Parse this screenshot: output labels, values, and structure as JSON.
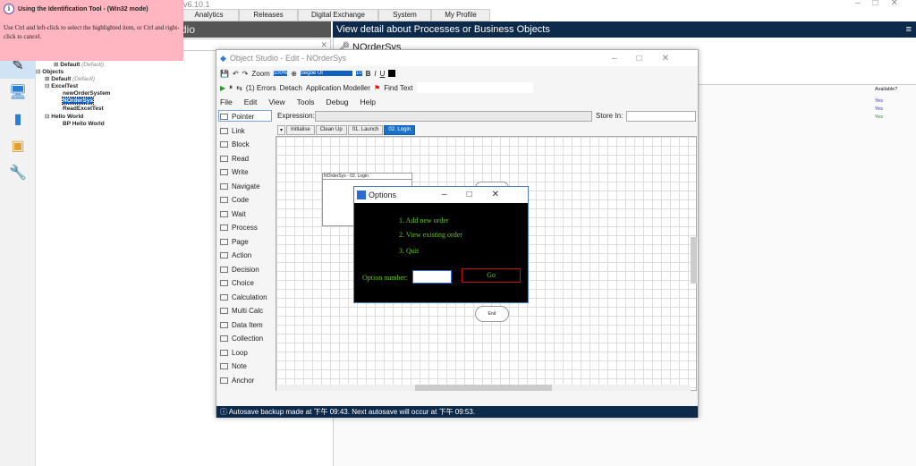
{
  "app": {
    "version": "v6.10.1",
    "nav_tabs": [
      "Analytics",
      "Releases",
      "Digital Exchange",
      "System",
      "My Profile"
    ],
    "left_header": "dio"
  },
  "tooltip": {
    "title": "Using the Identification Tool - (Win32 mode)",
    "body": "Use Ctrl and left-click to select the highlighted item, or Ctrl and right-click to cancel."
  },
  "tree": [
    {
      "label": "Default",
      "note": "(Default)"
    },
    {
      "label": "Objects"
    },
    {
      "label": "Default",
      "note": "(Default)"
    },
    {
      "label": "ExcelTest"
    },
    {
      "label": "newOrderSystem"
    },
    {
      "label": "NOrderSys",
      "selected": true
    },
    {
      "label": "ReadExcelTest"
    },
    {
      "label": "Hello World"
    },
    {
      "label": "BP Hello World"
    }
  ],
  "right": {
    "header": "View detail about Processes or Business Objects",
    "item_name": "NOrderSys",
    "column": "Available?",
    "rows": [
      "Yes",
      "Yes",
      "Yes"
    ],
    "row_colors": [
      "#3333cc",
      "#3333cc",
      "#2a8a2a"
    ]
  },
  "studio": {
    "title": "Object Studio  - Edit - NOrderSys",
    "zoom_label": "Zoom",
    "zoom": "100%",
    "font": "Segoe UI",
    "font_size": "10",
    "errors": "(1) Errors",
    "detach": "Detach",
    "app_modeller": "Application Modeller",
    "find_text": "Find Text",
    "menu": [
      "File",
      "Edit",
      "View",
      "Tools",
      "Debug",
      "Help"
    ],
    "expression_label": "Expression:",
    "store_in_label": "Store In:",
    "palette": [
      "Pointer",
      "Link",
      "Block",
      "Read",
      "Write",
      "Navigate",
      "Code",
      "Wait",
      "Process",
      "Page",
      "Action",
      "Decision",
      "Choice",
      "Calculation",
      "Multi Calc",
      "Data Item",
      "Collection",
      "Loop",
      "Note",
      "Anchor"
    ],
    "pages": [
      "Initialise",
      "Clean Up",
      "01. Launch",
      "02. Login"
    ],
    "active_page": "02. Login",
    "canvas_block": "NOrderSys - 02. Login",
    "end_label": "End",
    "status": "Autosave backup made at 下午 09:43. Next autosave will occur at 下午 09:53."
  },
  "options": {
    "title": "Options",
    "items": [
      "1. Add new order",
      "2. View existing order",
      "3. Quit"
    ],
    "option_label": "Option number:",
    "option_value": "",
    "go": "Go"
  }
}
